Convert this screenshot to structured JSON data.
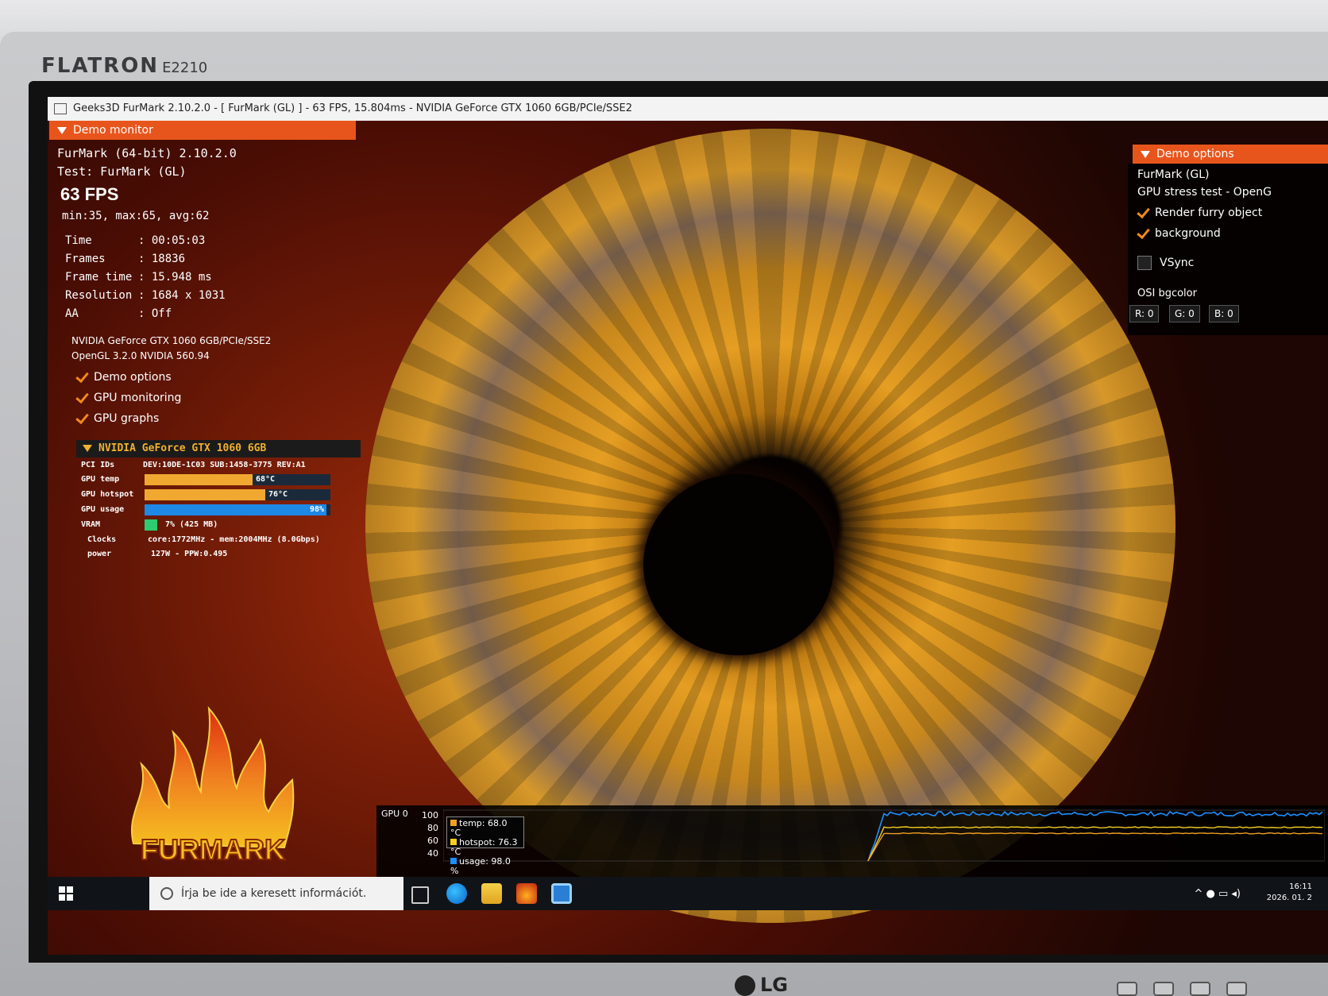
{
  "monitor": {
    "brand": "FLATRON",
    "model": "E2210",
    "maker": "LG"
  },
  "window": {
    "title": "Geeks3D FurMark 2.10.2.0 - [ FurMark (GL) ] - 63 FPS, 15.804ms - NVIDIA GeForce GTX 1060 6GB/PCIe/SSE2"
  },
  "left_panel": {
    "header": "Demo monitor",
    "app_line": "FurMark (64-bit) 2.10.2.0",
    "test_line": "Test: FurMark (GL)",
    "fps": "63 FPS",
    "fps_stats": "min:35, max:65, avg:62",
    "stats": [
      {
        "key": "Time",
        "value": ": 00:05:03"
      },
      {
        "key": "Frames",
        "value": ": 18836"
      },
      {
        "key": "Frame time",
        "value": ": 15.948 ms"
      },
      {
        "key": "Resolution",
        "value": ": 1684 x 1031"
      },
      {
        "key": "AA",
        "value": ": Off"
      }
    ],
    "gpu_renderer": "NVIDIA GeForce GTX 1060 6GB/PCIe/SSE2",
    "gl_version": "OpenGL 3.2.0 NVIDIA 560.94",
    "toggles": [
      {
        "label": "Demo options",
        "checked": true
      },
      {
        "label": "GPU monitoring",
        "checked": true
      },
      {
        "label": "GPU graphs",
        "checked": true
      }
    ]
  },
  "gpu_monitor": {
    "header": "NVIDIA GeForce GTX 1060 6GB",
    "pci_label": "PCI IDs",
    "pci_value": "DEV:10DE-1C03 SUB:1458-3775 REV:A1",
    "gpu_temp_label": "GPU temp",
    "gpu_temp_text": "68°C",
    "gpu_temp_fraction": 0.58,
    "gpu_hotspot_label": "GPU hotspot",
    "gpu_hotspot_text": "76°C",
    "gpu_hotspot_fraction": 0.65,
    "gpu_usage_label": "GPU usage",
    "gpu_usage_text": "98%",
    "gpu_usage_fraction": 0.98,
    "vram_label": "VRAM",
    "vram_text": "7% (425 MB)",
    "vram_fraction": 0.07,
    "clocks_label": "Clocks",
    "clocks_value": "core:1772MHz - mem:2004MHz (8.0Gbps)",
    "power_label": "power",
    "power_value": "127W - PPW:0.495",
    "colors": {
      "temp": "#f0a830",
      "usage": "#1e88e5",
      "vram": "#2ecc71"
    }
  },
  "logo_text": "FURMARK",
  "right_panel": {
    "header": "Demo options",
    "test_name": "FurMark (GL)",
    "test_desc": "GPU stress test - OpenG",
    "render_furry": "Render furry object",
    "background": "background",
    "vsync": "VSync",
    "osi_label": "OSI bgcolor",
    "r": "R: 0",
    "g": "G: 0",
    "b": "B: 0"
  },
  "graph": {
    "title": "GPU 0",
    "y_ticks": [
      "100",
      "80",
      "60",
      "40"
    ],
    "legend": {
      "temp": "temp: 68.0 °C",
      "hotspot": "hotspot: 76.3 °C",
      "usage": "usage: 98.0 %"
    },
    "colors": {
      "temp": "#f0a020",
      "hotspot": "#f5d020",
      "usage": "#1e90ff"
    }
  },
  "taskbar": {
    "search_placeholder": "Írja be ide a keresett információt.",
    "time": "16:11",
    "date": "2026. 01. 2"
  }
}
